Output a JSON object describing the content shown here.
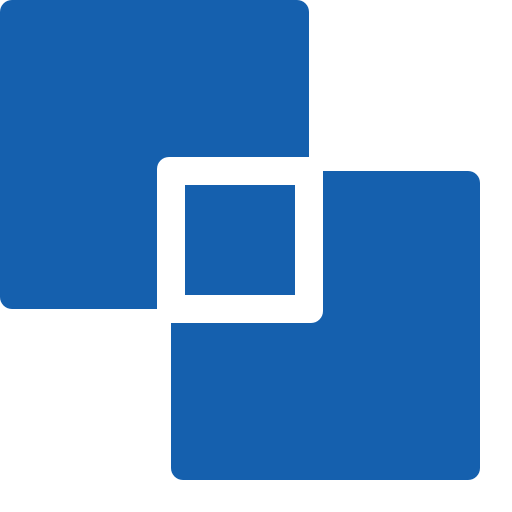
{
  "icon": {
    "name": "overlapping-squares-icon",
    "primary_color": "#1560AE",
    "gap_color": "#FFFFFF"
  }
}
